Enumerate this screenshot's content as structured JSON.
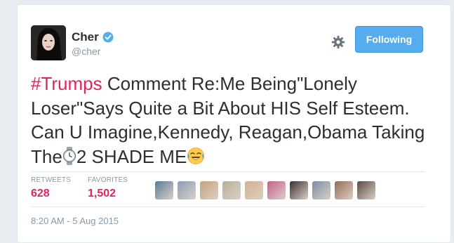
{
  "header": {
    "display_name": "Cher",
    "handle": "@cher",
    "follow_label": "Following"
  },
  "tweet": {
    "hashtag": "#Trumps",
    "text_1": " Comment Re:Me Being\"Lonely Loser\"Says Quite a Bit About HIS Self Esteem. Can U Imagine,Kennedy, Reagan,Obama Taking The",
    "text_2": "2 SHADE ME",
    "emojis": [
      "watch-emoji",
      "laughing-crying-emoji"
    ]
  },
  "stats": {
    "retweets_label": "RETWEETS",
    "retweets_value": "628",
    "favorites_label": "FAVORITES",
    "favorites_value": "1,502"
  },
  "favoriters": {
    "colors": [
      "#5a7c9a",
      "#8a9fb8",
      "#c9a27a",
      "#b7b09a",
      "#d8b08c",
      "#c7608a",
      "#3a3030",
      "#7a8fa6",
      "#9a6b55",
      "#5a4a42"
    ]
  },
  "timestamp": "8:20 AM - 5 Aug 2015",
  "colors": {
    "accent": "#55acee",
    "hashtag": "#e0245e",
    "text": "#292f33",
    "muted": "#8899a6"
  }
}
